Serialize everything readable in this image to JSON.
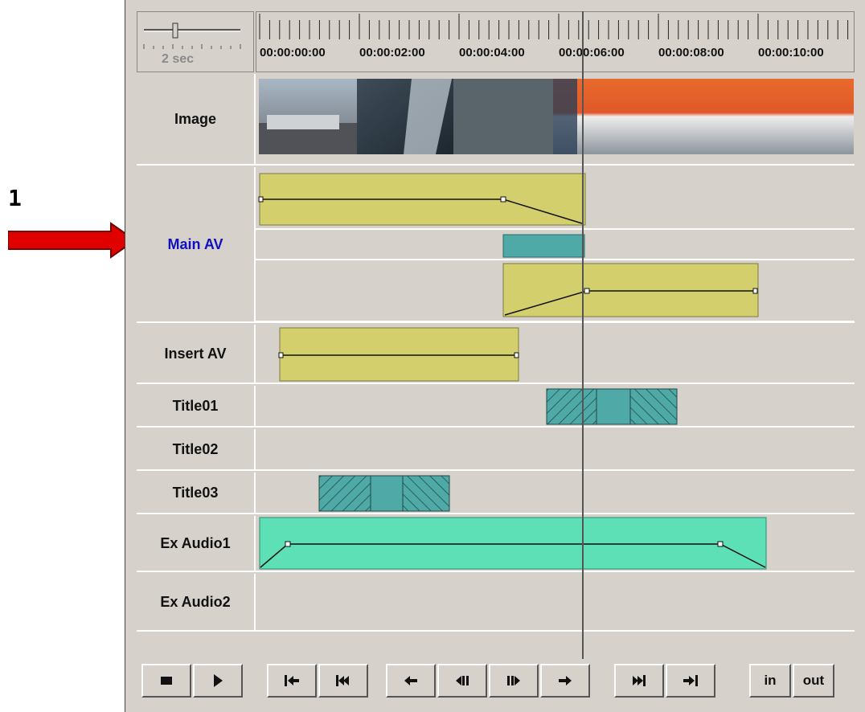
{
  "callout": {
    "number": "1",
    "arrow_color": "#e00000"
  },
  "ruler": {
    "zoom_label": "2 sec",
    "timecodes": [
      "00:00:00:00",
      "00:00:02:00",
      "00:00:04:00",
      "00:00:06:00",
      "00:00:08:00",
      "00:00:10:00"
    ]
  },
  "tracks": [
    {
      "label": "Image"
    },
    {
      "label": "Main AV",
      "color": "#1010c0"
    },
    {
      "label": "Insert AV"
    },
    {
      "label": "Title01"
    },
    {
      "label": "Title02"
    },
    {
      "label": "Title03"
    },
    {
      "label": "Ex Audio1"
    },
    {
      "label": "Ex Audio2"
    }
  ],
  "clip_colors": {
    "video": "#d2cf6c",
    "transition": "#4fa9a6",
    "audio": "#5de0b6"
  },
  "transport": {
    "in_label": "in",
    "out_label": "out",
    "buttons": [
      {
        "name": "stop-button",
        "icon": "stop-icon"
      },
      {
        "name": "play-button",
        "icon": "play-icon"
      },
      {
        "name": "go-to-start-button",
        "icon": "go-to-start-icon"
      },
      {
        "name": "prev-edit-button",
        "icon": "previous-edit-icon"
      },
      {
        "name": "step-back-button",
        "icon": "arrow-left-icon"
      },
      {
        "name": "frame-back-button",
        "icon": "frame-back-icon"
      },
      {
        "name": "frame-forward-button",
        "icon": "frame-forward-icon"
      },
      {
        "name": "step-forward-button",
        "icon": "arrow-right-icon"
      },
      {
        "name": "next-edit-button",
        "icon": "next-edit-icon"
      },
      {
        "name": "go-to-end-button",
        "icon": "go-to-end-icon"
      }
    ]
  }
}
